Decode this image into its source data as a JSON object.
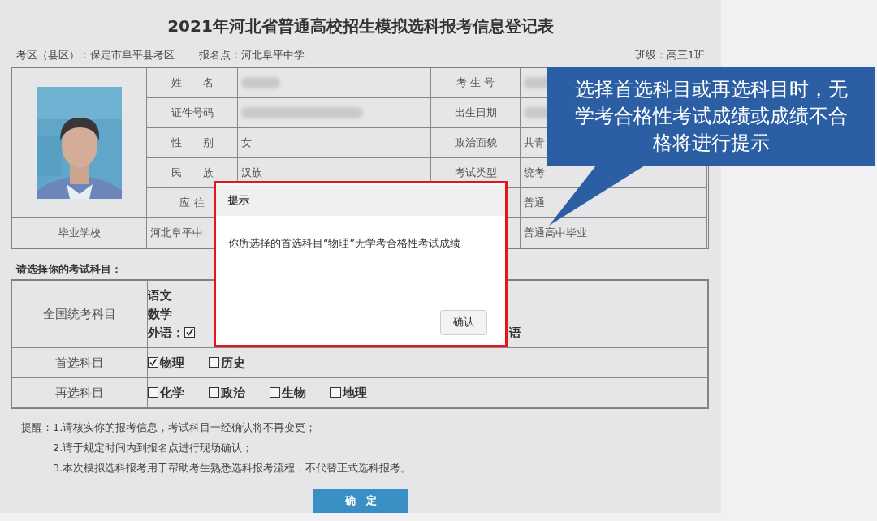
{
  "title": "2021年河北省普通高校招生模拟选科报考信息登记表",
  "header": {
    "exam_area": "考区（县区）：保定市阜平县考区",
    "registration_point": "报名点：河北阜平中学",
    "class": "班级：高三1班"
  },
  "photo": {
    "kind": "picture"
  },
  "info_rows": [
    [
      {
        "kind": "label",
        "text": "姓　　名"
      },
      {
        "kind": "blurred"
      },
      {
        "kind": "label",
        "text": "考 生 号"
      },
      {
        "kind": "blurred"
      }
    ],
    [
      {
        "kind": "label",
        "text": "证件号码"
      },
      {
        "kind": "blurred"
      },
      {
        "kind": "label",
        "text": "出生日期"
      },
      {
        "kind": "blurred"
      }
    ],
    [
      {
        "kind": "label",
        "text": "性　　别"
      },
      {
        "kind": "value",
        "text": "女"
      },
      {
        "kind": "label",
        "text": "政治面貌"
      },
      {
        "kind": "value",
        "text": "共青"
      }
    ],
    [
      {
        "kind": "label",
        "text": "民　　族"
      },
      {
        "kind": "value",
        "text": "汉族"
      },
      {
        "kind": "label",
        "text": "考试类型"
      },
      {
        "kind": "value",
        "text": "统考"
      }
    ],
    [
      {
        "kind": "label",
        "text": "应 往"
      },
      {
        "kind": "value"
      },
      {
        "kind": "label"
      },
      {
        "kind": "value",
        "text": "普通"
      }
    ]
  ],
  "graduation_row": [
    {
      "kind": "label",
      "text": "毕业学校"
    },
    {
      "kind": "value",
      "text": "河北阜平中"
    },
    {
      "kind": "label"
    },
    {
      "kind": "value",
      "text": "普通高中毕业"
    }
  ],
  "subjects_heading": "请选择你的考试科目：",
  "subject_rows": [
    {
      "kind": "fixed",
      "label": "全国统考科目",
      "lines": [
        "语文",
        "数学"
      ],
      "foreign": {
        "prefix": "外语：",
        "options": [
          {
            "checked": true
          }
        ],
        "fragment": "语"
      }
    },
    {
      "kind": "choice",
      "label": "首选科目",
      "options": [
        {
          "text": "物理",
          "checked": true
        },
        {
          "text": "历史",
          "checked": false
        }
      ]
    },
    {
      "kind": "choice",
      "label": "再选科目",
      "options": [
        {
          "text": "化学",
          "checked": false
        },
        {
          "text": "政治",
          "checked": false
        },
        {
          "text": "生物",
          "checked": false
        },
        {
          "text": "地理",
          "checked": false
        }
      ]
    }
  ],
  "notes": {
    "prefix": "提醒：",
    "lines": [
      "1.请核实你的报考信息，考试科目一经确认将不再变更；",
      "2.请于规定时间内到报名点进行现场确认；",
      "3.本次模拟选科报考用于帮助考生熟悉选科报考流程，不代替正式选科报考。"
    ]
  },
  "submit_button": "确　定",
  "dialog": {
    "title": "提示",
    "message": "你所选择的首选科目“物理”无学考合格性考试成绩",
    "button": "确认",
    "highlighted": true
  },
  "callout": {
    "text": "选择首选科目或再选科目时，无学考合格性考试成绩或成绩不合格将进行提示"
  }
}
